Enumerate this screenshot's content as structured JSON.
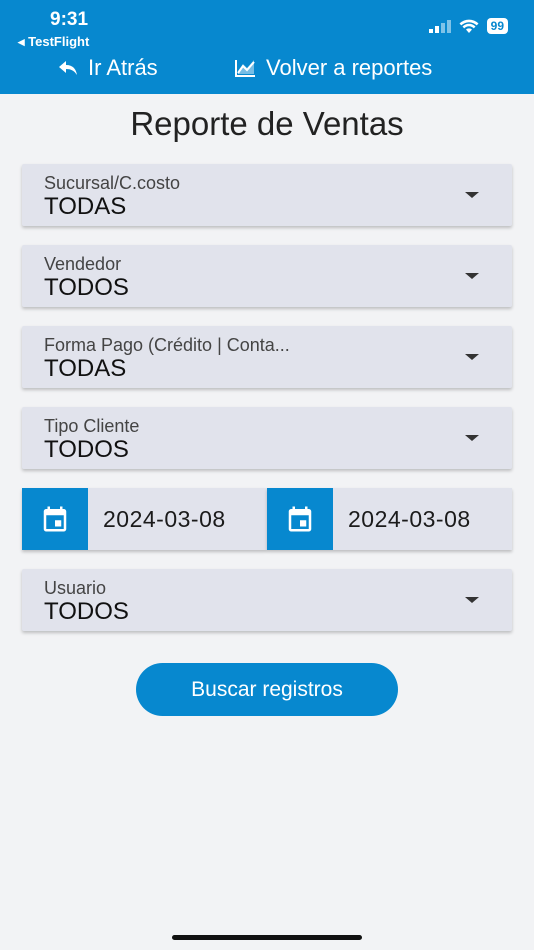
{
  "status_bar": {
    "time": "9:31",
    "back_app": "◂ TestFlight",
    "battery": "99"
  },
  "nav": {
    "back_label": "Ir Atrás",
    "reports_label": "Volver a reportes"
  },
  "page": {
    "title": "Reporte de Ventas"
  },
  "filters": {
    "sucursal": {
      "label": "Sucursal/C.costo",
      "value": "TODAS"
    },
    "vendedor": {
      "label": "Vendedor",
      "value": "TODOS"
    },
    "forma_pago": {
      "label": "Forma Pago (Crédito | Conta...",
      "value": "TODAS"
    },
    "tipo_cliente": {
      "label": "Tipo Cliente",
      "value": "TODOS"
    },
    "usuario": {
      "label": "Usuario",
      "value": "TODOS"
    }
  },
  "dates": {
    "from": "2024-03-08",
    "to": "2024-03-08"
  },
  "actions": {
    "search_label": "Buscar registros"
  },
  "colors": {
    "primary": "#0788cf",
    "field_bg": "#e1e3ec",
    "page_bg": "#f2f3f5"
  }
}
